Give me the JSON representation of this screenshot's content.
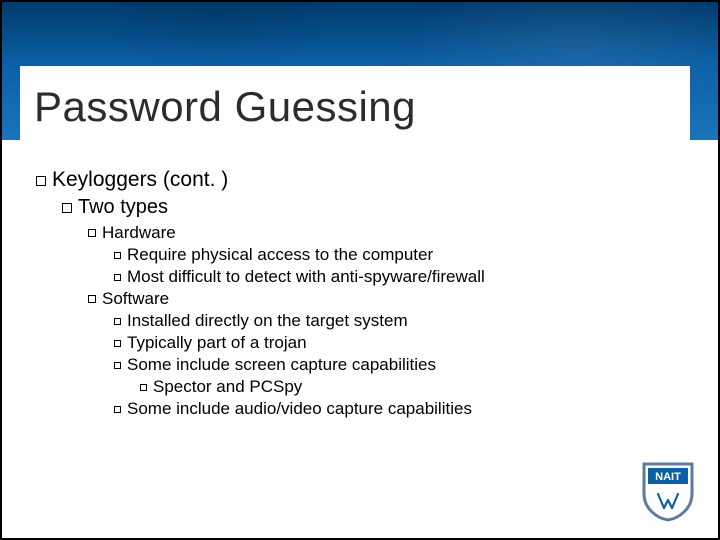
{
  "slide": {
    "title": "Password Guessing",
    "bullets": {
      "l1": "Keyloggers (cont. )",
      "l2": "Two types",
      "l3a": "Hardware",
      "l4a": "Require physical access to the computer",
      "l4b": "Most difficult to detect with anti-spyware/firewall",
      "l3b": "Software",
      "l4c": "Installed directly on the target system",
      "l4d": "Typically part of a trojan",
      "l4e": "Some include screen capture capabilities",
      "l5a": "Spector and PCSpy",
      "l4f": "Some include audio/video capture capabilities"
    }
  },
  "logo": {
    "label": "NAIT",
    "colors": {
      "shield_outer": "#5b7ca0",
      "shield_inner": "#ffffff",
      "band": "#0b5fa5",
      "text": "#ffffff"
    }
  }
}
